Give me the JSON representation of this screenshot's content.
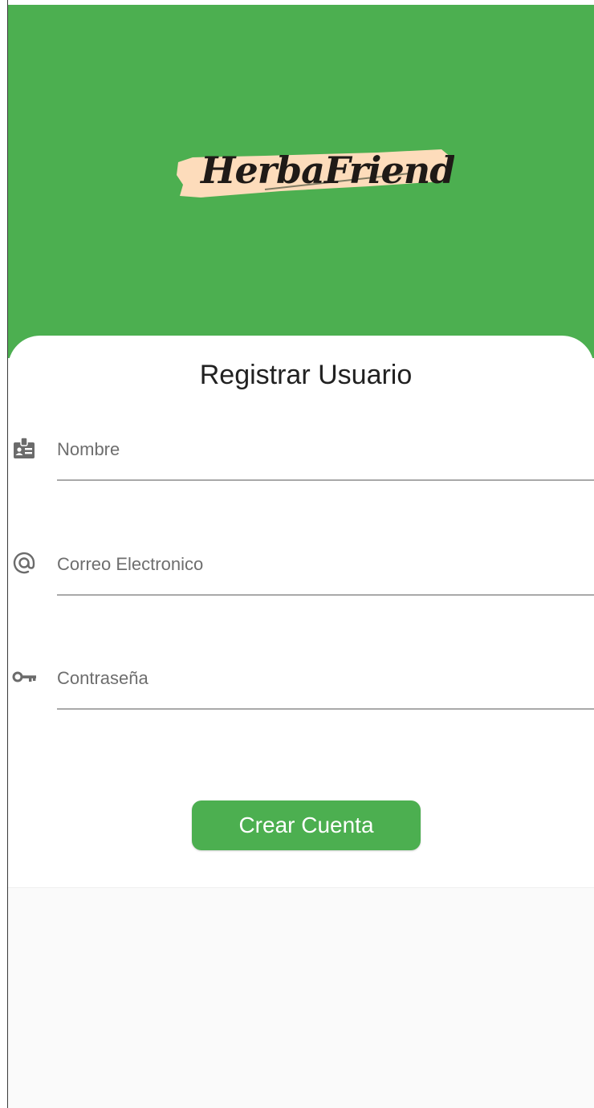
{
  "brand": {
    "name": "HerbaFriend",
    "header_color": "#4caf50",
    "logo_brush_color": "#fddcbb"
  },
  "form": {
    "title": "Registrar Usuario",
    "fields": [
      {
        "icon": "badge-icon",
        "placeholder": "Nombre",
        "value": ""
      },
      {
        "icon": "at-sign-icon",
        "placeholder": "Correo Electronico",
        "value": ""
      },
      {
        "icon": "key-icon",
        "placeholder": "Contraseña",
        "value": ""
      }
    ],
    "submit_label": "Crear Cuenta",
    "button_color": "#4caf50"
  }
}
